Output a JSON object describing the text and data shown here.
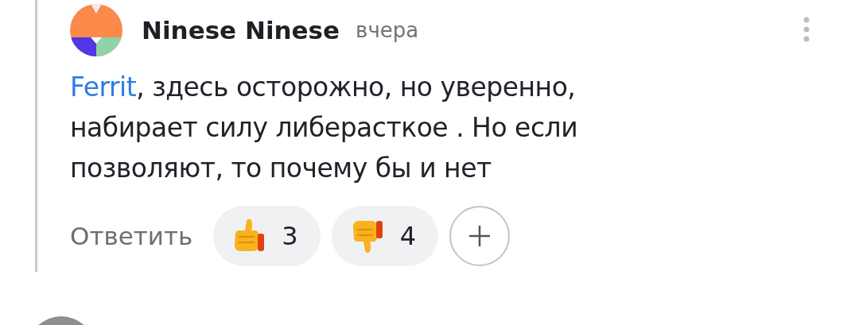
{
  "comment": {
    "author": "Ninese Ninese",
    "time": "вчера",
    "mention": "Ferrit",
    "text": ", здесь осторожно, но уверенно, набирает силу либерасткое . Но если позволяют, то почему бы и нет",
    "reply": "Ответить",
    "reactions": [
      {
        "kind": "like",
        "count": "3"
      },
      {
        "kind": "dislike",
        "count": "4"
      }
    ]
  }
}
